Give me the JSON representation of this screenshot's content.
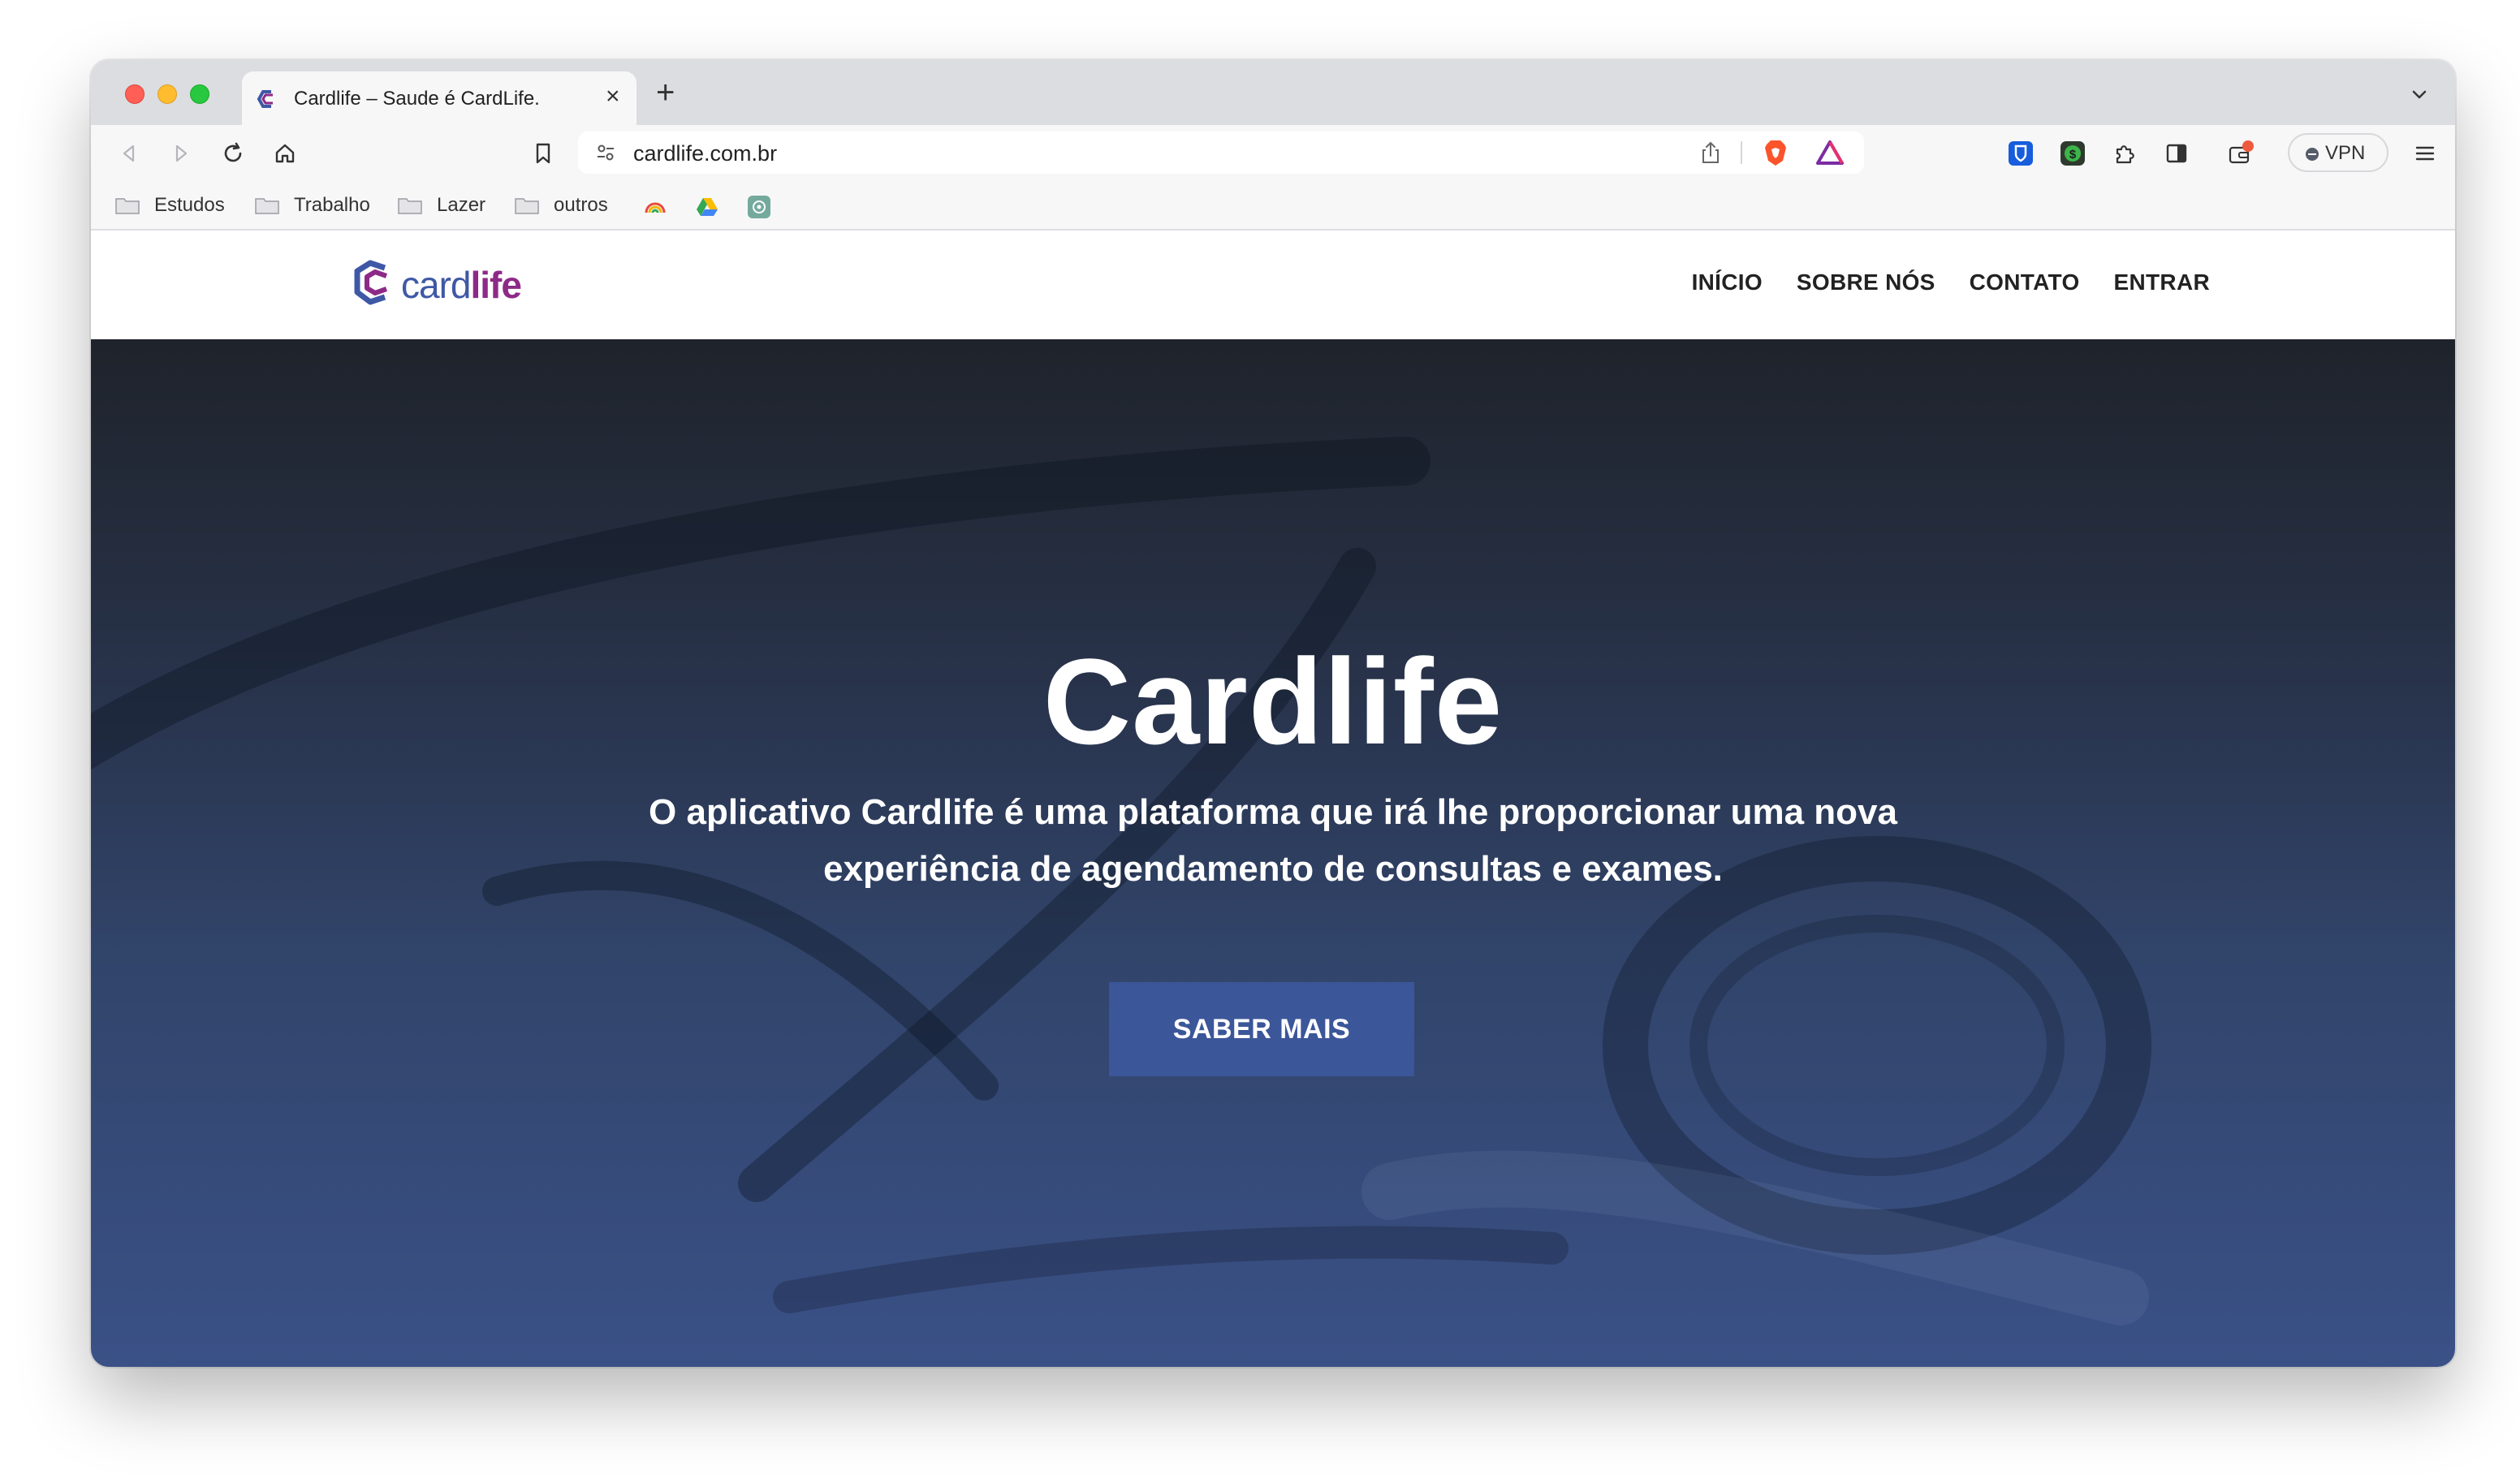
{
  "browser": {
    "tab": {
      "title": "Cardlife – Saude é CardLife.",
      "close_glyph": "×"
    },
    "new_tab_glyph": "+",
    "toolbar": {
      "url": "cardlife.com.br",
      "vpn_label": "VPN"
    },
    "bookmarks": [
      {
        "label": "Estudos",
        "icon": "folder-icon"
      },
      {
        "label": "Trabalho",
        "icon": "folder-icon"
      },
      {
        "label": "Lazer",
        "icon": "folder-icon"
      },
      {
        "label": "outros",
        "icon": "folder-icon"
      }
    ],
    "bookmark_icons": [
      "rainbow-icon",
      "google-drive-icon",
      "chatgpt-icon"
    ],
    "extension_icons": [
      "bitwarden-icon",
      "money-extension-icon",
      "puzzle-icon",
      "sidebar-icon",
      "wallet-icon",
      "menu-icon"
    ]
  },
  "site": {
    "logo": {
      "part1": "card",
      "part2": "life"
    },
    "nav": [
      {
        "label": "INÍCIO"
      },
      {
        "label": "SOBRE NÓS"
      },
      {
        "label": "CONTATO"
      },
      {
        "label": "ENTRAR"
      }
    ],
    "hero": {
      "title": "Cardlife",
      "subtitle_line1": "O aplicativo Cardlife é uma plataforma que irá lhe proporcionar uma nova",
      "subtitle_line2": "experiência de agendamento de consultas e exames.",
      "cta": "SABER MAIS"
    }
  },
  "colors": {
    "brand_blue": "#3f58a6",
    "brand_purple": "#8d2a87",
    "cta_bg": "#3b5699",
    "hero_top": "#1f232b",
    "hero_bottom": "#3a5187"
  }
}
